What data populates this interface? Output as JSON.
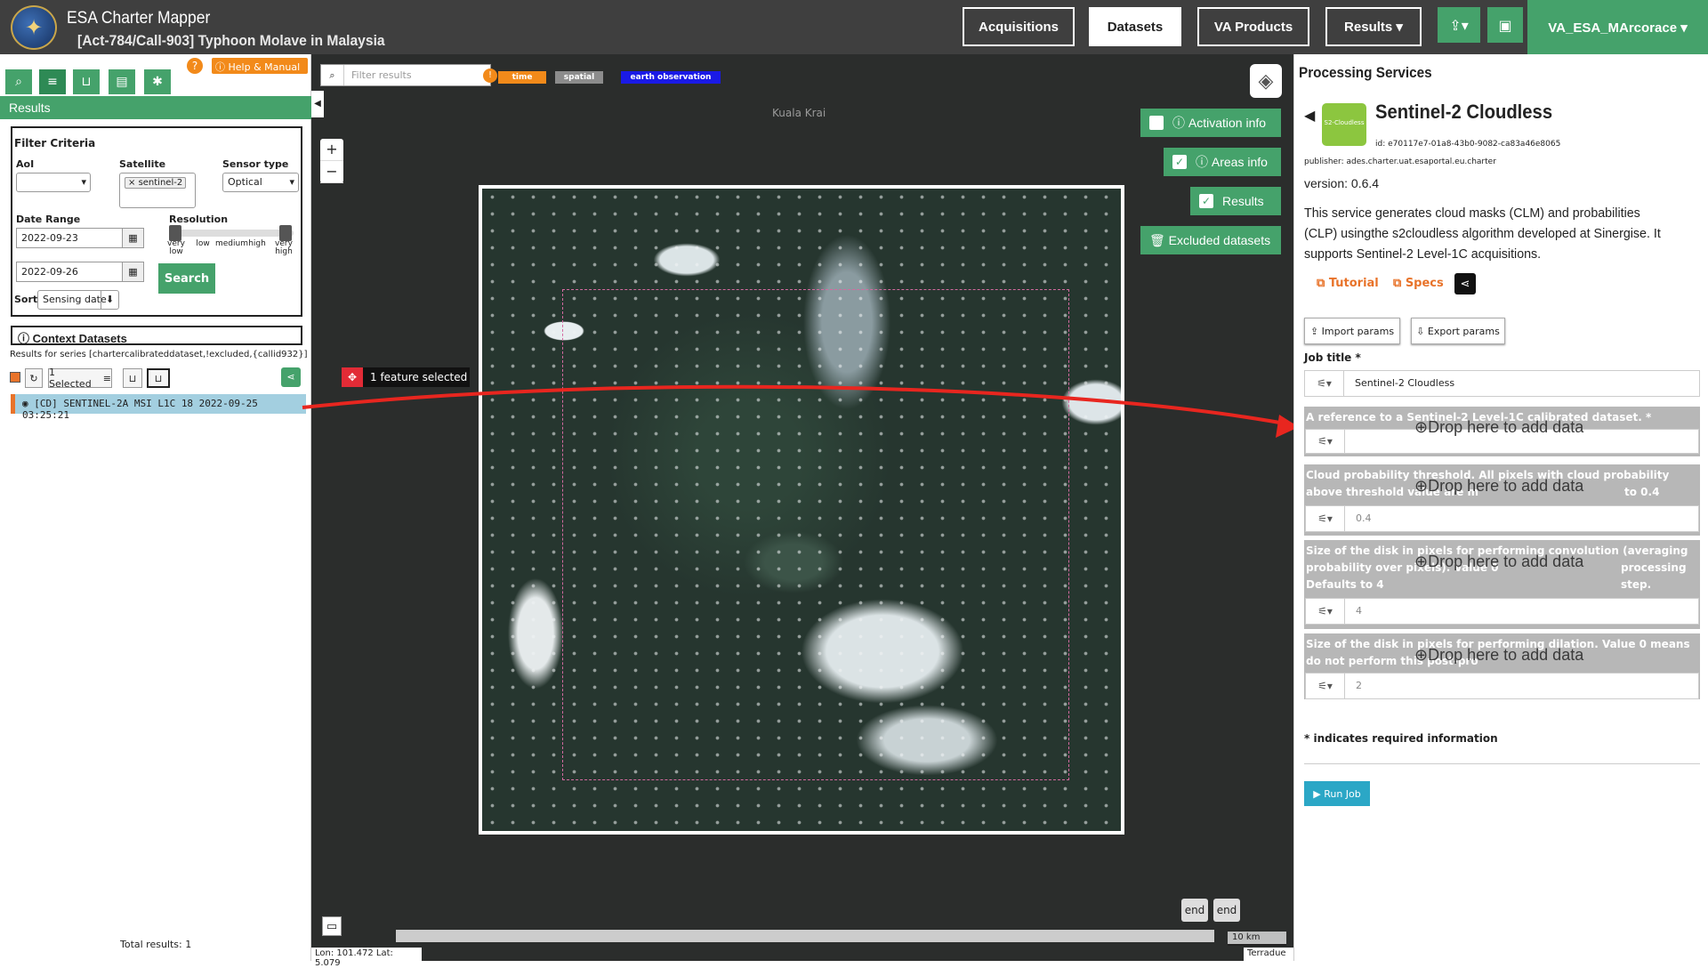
{
  "app": {
    "title": "ESA Charter Mapper",
    "subtitle": "[Act-784/Call-903] Typhoon Molave in Malaysia"
  },
  "nav": {
    "acquisitions": "Acquisitions",
    "datasets": "Datasets",
    "va_products": "VA Products",
    "results": "Results ▾",
    "user": "VA_ESA_MArcorace ▾"
  },
  "left": {
    "help": "Help & Manual",
    "results_title": "Results",
    "filter": {
      "title": "Filter Criteria",
      "aoi_label": "AoI",
      "satellite_label": "Satellite",
      "satellite_value": "sentinel-2",
      "sensor_label": "Sensor type",
      "sensor_value": "Optical",
      "date_label": "Date Range",
      "date_from": "2022-09-23",
      "date_to": "2022-09-26",
      "resolution_label": "Resolution",
      "res_levels": [
        "very low",
        "low",
        "medium",
        "high",
        "very high"
      ],
      "sort_label": "Sort",
      "sort_value": "Sensing date",
      "search": "Search"
    },
    "context": {
      "title": "Context Datasets",
      "series": "Results for series [chartercalibrateddataset,!excluded,{callid932}]",
      "selected": "1 Selected",
      "row": "[CD] SENTINEL-2A MSI L1C 18 2022-09-25 03:25:21",
      "total": "Total results: 1"
    }
  },
  "map": {
    "filter_placeholder": "Filter results",
    "tags": [
      {
        "label": "time",
        "color": "#f28a1a"
      },
      {
        "label": "spatial",
        "color": "#8c8c8c"
      },
      {
        "label": "earth observation",
        "color": "#1a1ae6"
      }
    ],
    "place": "Kuala Krai",
    "activation_info": "Activation info",
    "areas_info": "Areas info",
    "results": "Results",
    "excluded": "Excluded datasets",
    "feature_selected": "1 feature selected",
    "end1": "end",
    "end2": "end",
    "coords": "Lon: 101.472 Lat: 5.079",
    "scale": "10 km",
    "attribution": "Terradue"
  },
  "processing": {
    "title": "Processing Services",
    "service_name": "Sentinel-2 Cloudless",
    "icon_text": "S2-Cloudless",
    "id": "id: e70117e7-01a8-43b0-9082-ca83a46e8065",
    "publisher": "publisher: ades.charter.uat.esaportal.eu.charter",
    "version": "version: 0.6.4",
    "description": "This service generates cloud masks (CLM) and probabilities (CLP) usingthe s2cloudless algorithm developed at Sinergise. It supports Sentinel-2 Level-1C acquisitions.",
    "tutorial": "Tutorial",
    "specs": "Specs",
    "import": "Import params",
    "export": "Export params",
    "job_title_label": "Job title *",
    "job_title_value": "Sentinel-2 Cloudless",
    "drop": "Drop here to add data",
    "param1": "A reference to a Sentinel-2 Level-1C calibrated dataset. *",
    "param2": "Cloud probability threshold. All pixels with cloud probability above threshold value are m",
    "param2b": "to 0.4",
    "param2_value": "0.4",
    "param3": "Size of the disk in pixels for performing convolution (averaging probability over pixels). Value 0",
    "param3b": "processing step.",
    "param3c": "Defaults to 4",
    "param3_value": "4",
    "param4": "Size of the disk in pixels for performing dilation. Value 0 means do not perform this post-pro",
    "param4_value": "2",
    "required_note": "* indicates required information",
    "run": "Run Job"
  }
}
